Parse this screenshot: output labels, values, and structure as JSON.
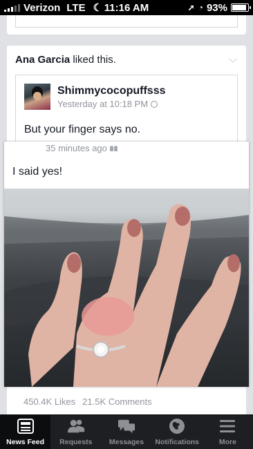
{
  "status_bar": {
    "carrier": "Verizon",
    "network": "LTE",
    "time": "11:16 AM",
    "battery": "93%",
    "battery_level": 0.93
  },
  "post": {
    "liker": "Ana Garcia",
    "liked_text": "liked this.",
    "shared": {
      "author": "Shimmycocopuffsss",
      "timestamp": "Yesterday at 10:18 PM",
      "text": "But your finger says no."
    },
    "likes": "450.4K Likes",
    "comments": "21.5K Comments"
  },
  "overlay_post": {
    "timestamp": "35 minutes ago",
    "text": "I said yes!",
    "image_description_icon": "photo-of-hand-with-ring"
  },
  "tab_bar": {
    "tabs": [
      {
        "label": "News Feed",
        "icon": "news-feed-icon",
        "active": true
      },
      {
        "label": "Requests",
        "icon": "requests-icon",
        "active": false
      },
      {
        "label": "Messages",
        "icon": "messages-icon",
        "active": false
      },
      {
        "label": "Notifications",
        "icon": "notifications-icon",
        "active": false
      },
      {
        "label": "More",
        "icon": "more-icon",
        "active": false
      }
    ]
  },
  "colors": {
    "background": "#dfe1e5",
    "tab_bar": "#1d1f22",
    "secondary_text": "#90949c"
  }
}
